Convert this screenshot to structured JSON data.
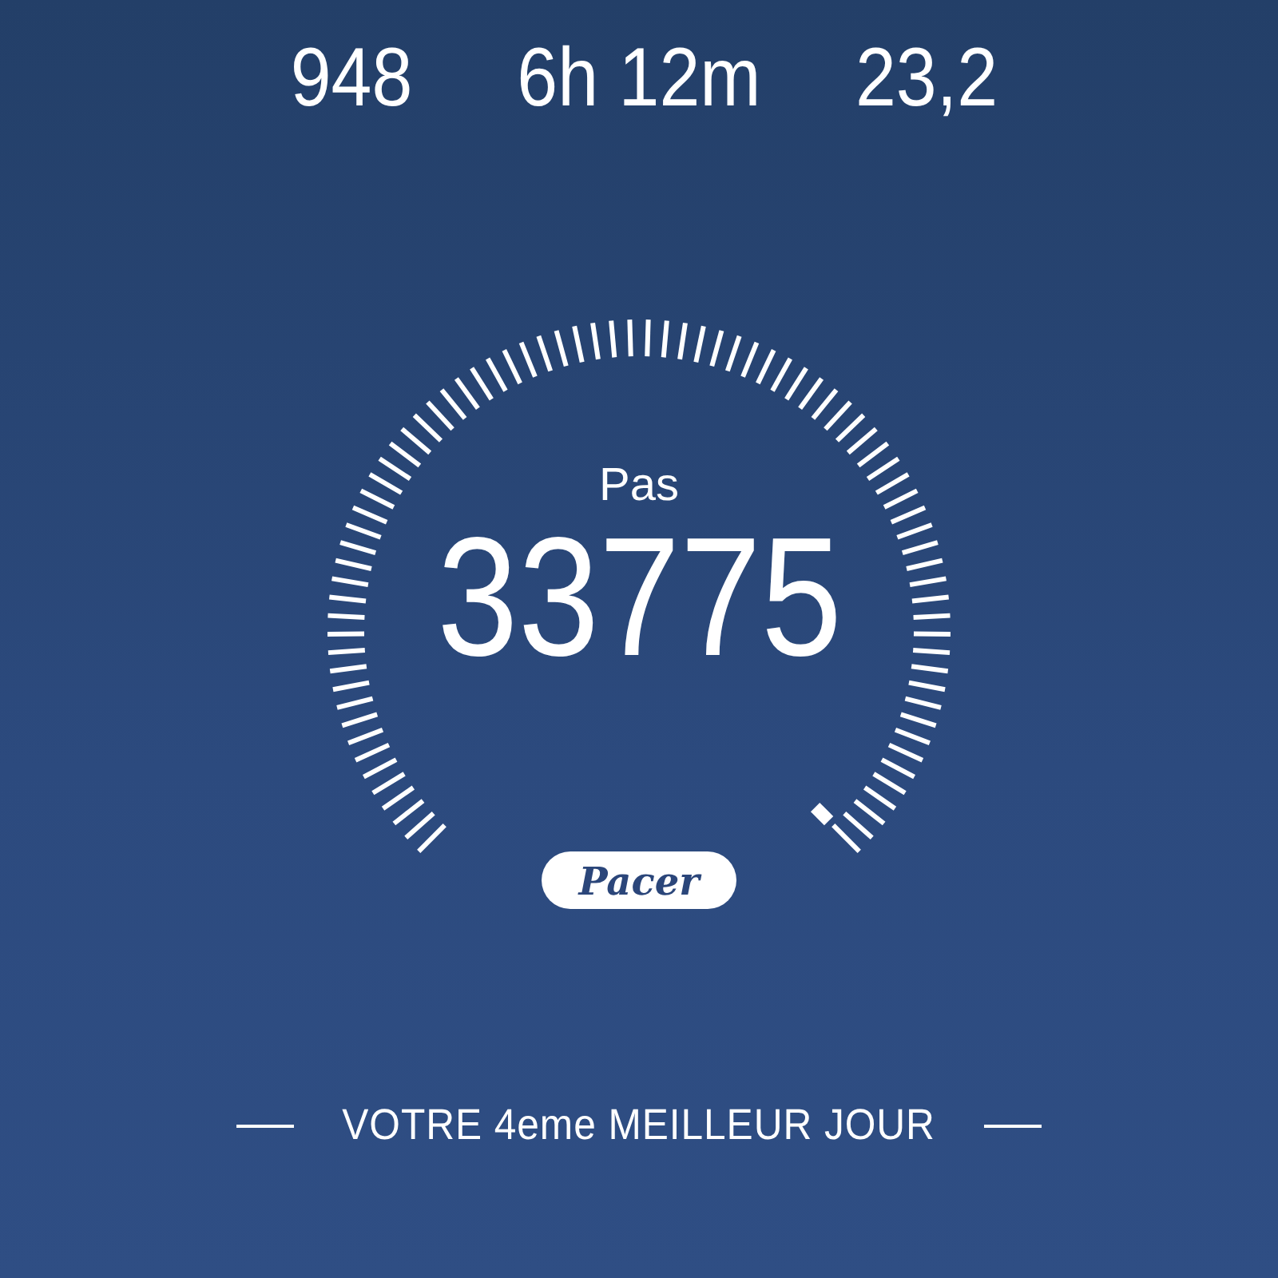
{
  "stats": [
    {
      "value": "948"
    },
    {
      "value": "6h 12m"
    },
    {
      "value": "23,2"
    }
  ],
  "gauge": {
    "label": "Pas",
    "value": "33775"
  },
  "badge": {
    "text": "Pacer"
  },
  "footer": {
    "text": "VOTRE 4eme MEILLEUR JOUR"
  }
}
